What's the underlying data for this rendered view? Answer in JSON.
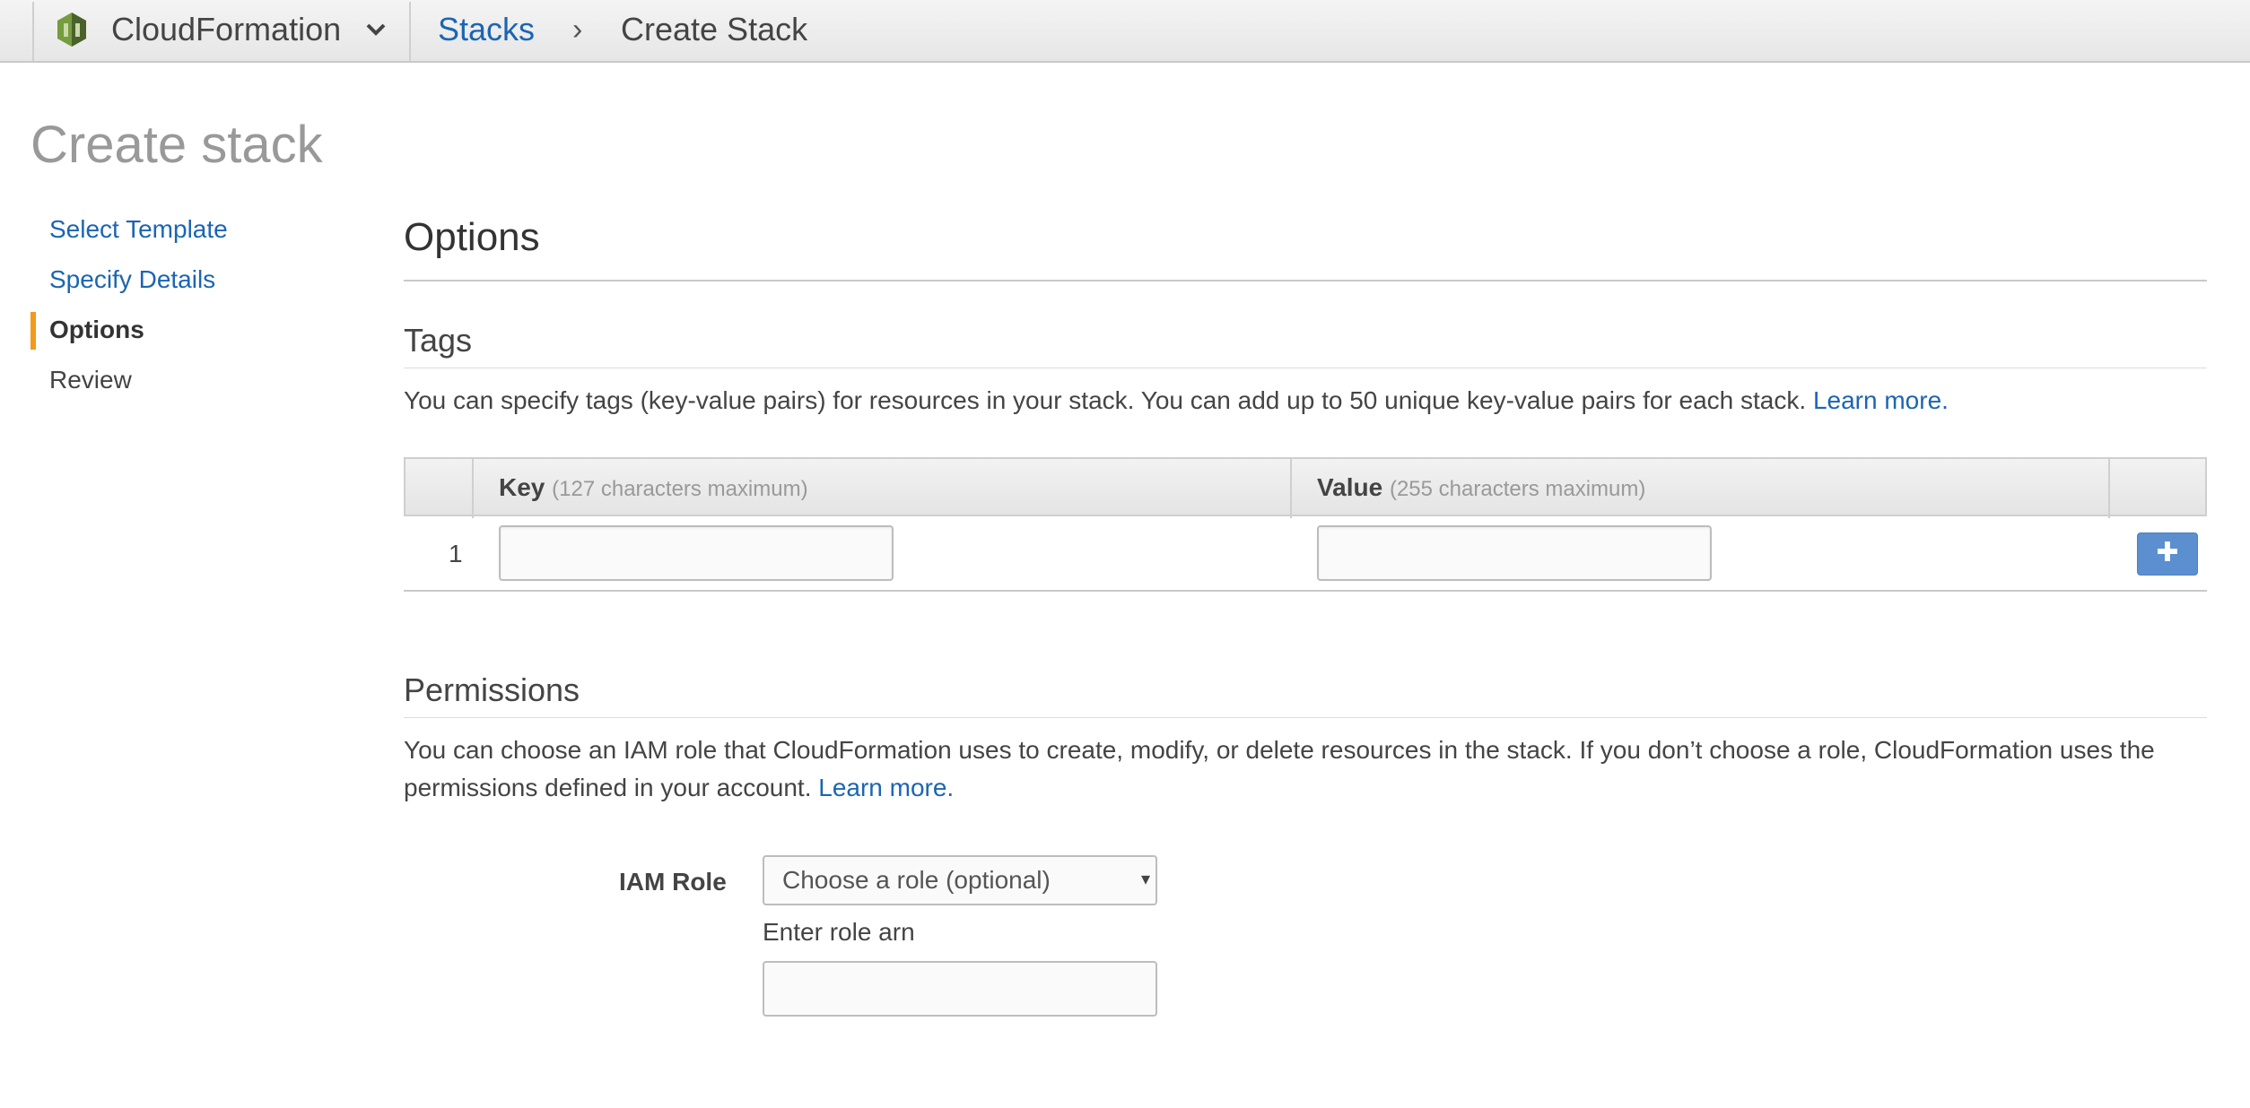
{
  "topbar": {
    "service_name": "CloudFormation",
    "logo_icon": "cloudformation-logo-icon",
    "menu_icon": "chevron-down-icon",
    "breadcrumb": {
      "link": "Stacks",
      "separator": "›",
      "current": "Create Stack"
    }
  },
  "page": {
    "title": "Create stack"
  },
  "steps": {
    "items": [
      {
        "label": "Select Template",
        "state": "link"
      },
      {
        "label": "Specify Details",
        "state": "link"
      },
      {
        "label": "Options",
        "state": "active"
      },
      {
        "label": "Review",
        "state": "plain"
      }
    ],
    "active_color": "#f39a1d"
  },
  "options": {
    "heading": "Options",
    "tags": {
      "title": "Tags",
      "description": "You can specify tags (key-value pairs) for resources in your stack. You can add up to 50 unique key-value pairs for each stack.",
      "learn_more": "Learn more.",
      "table": {
        "key_header": "Key",
        "key_hint": "(127 characters maximum)",
        "value_header": "Value",
        "value_hint": "(255 characters maximum)",
        "rows": [
          {
            "number": "1",
            "key": "",
            "value": ""
          }
        ],
        "add_label": "✚",
        "add_icon": "plus-icon"
      }
    },
    "permissions": {
      "title": "Permissions",
      "description": "You can choose an IAM role that CloudFormation uses to create, modify, or delete resources in the stack. If you don’t choose a role, CloudFormation uses the permissions defined in your account.",
      "learn_more": "Learn more.",
      "iam_role_label": "IAM Role",
      "iam_role_select": "Choose a role (optional)",
      "select_arrow": "▾",
      "arn_label": "Enter role arn",
      "arn_value": ""
    }
  },
  "colors": {
    "link": "#1b65b3",
    "add_button": "#5b8fd0",
    "title_gray": "#999999"
  }
}
